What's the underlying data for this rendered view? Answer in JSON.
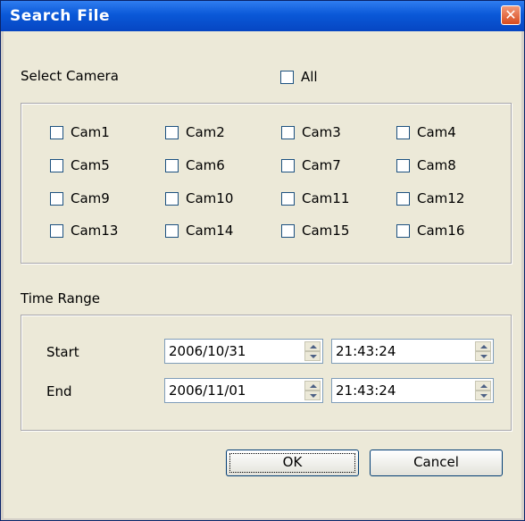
{
  "window": {
    "title": "Search File",
    "close_glyph": "✕"
  },
  "camera": {
    "section_label": "Select Camera",
    "all_label": "All",
    "cams": [
      "Cam1",
      "Cam2",
      "Cam3",
      "Cam4",
      "Cam5",
      "Cam6",
      "Cam7",
      "Cam8",
      "Cam9",
      "Cam10",
      "Cam11",
      "Cam12",
      "Cam13",
      "Cam14",
      "Cam15",
      "Cam16"
    ]
  },
  "time": {
    "section_label": "Time Range",
    "start_label": "Start",
    "end_label": "End",
    "start_date": "2006/10/31",
    "start_time": "21:43:24",
    "end_date": "2006/11/01",
    "end_time": "21:43:24"
  },
  "buttons": {
    "ok": "OK",
    "cancel": "Cancel"
  }
}
